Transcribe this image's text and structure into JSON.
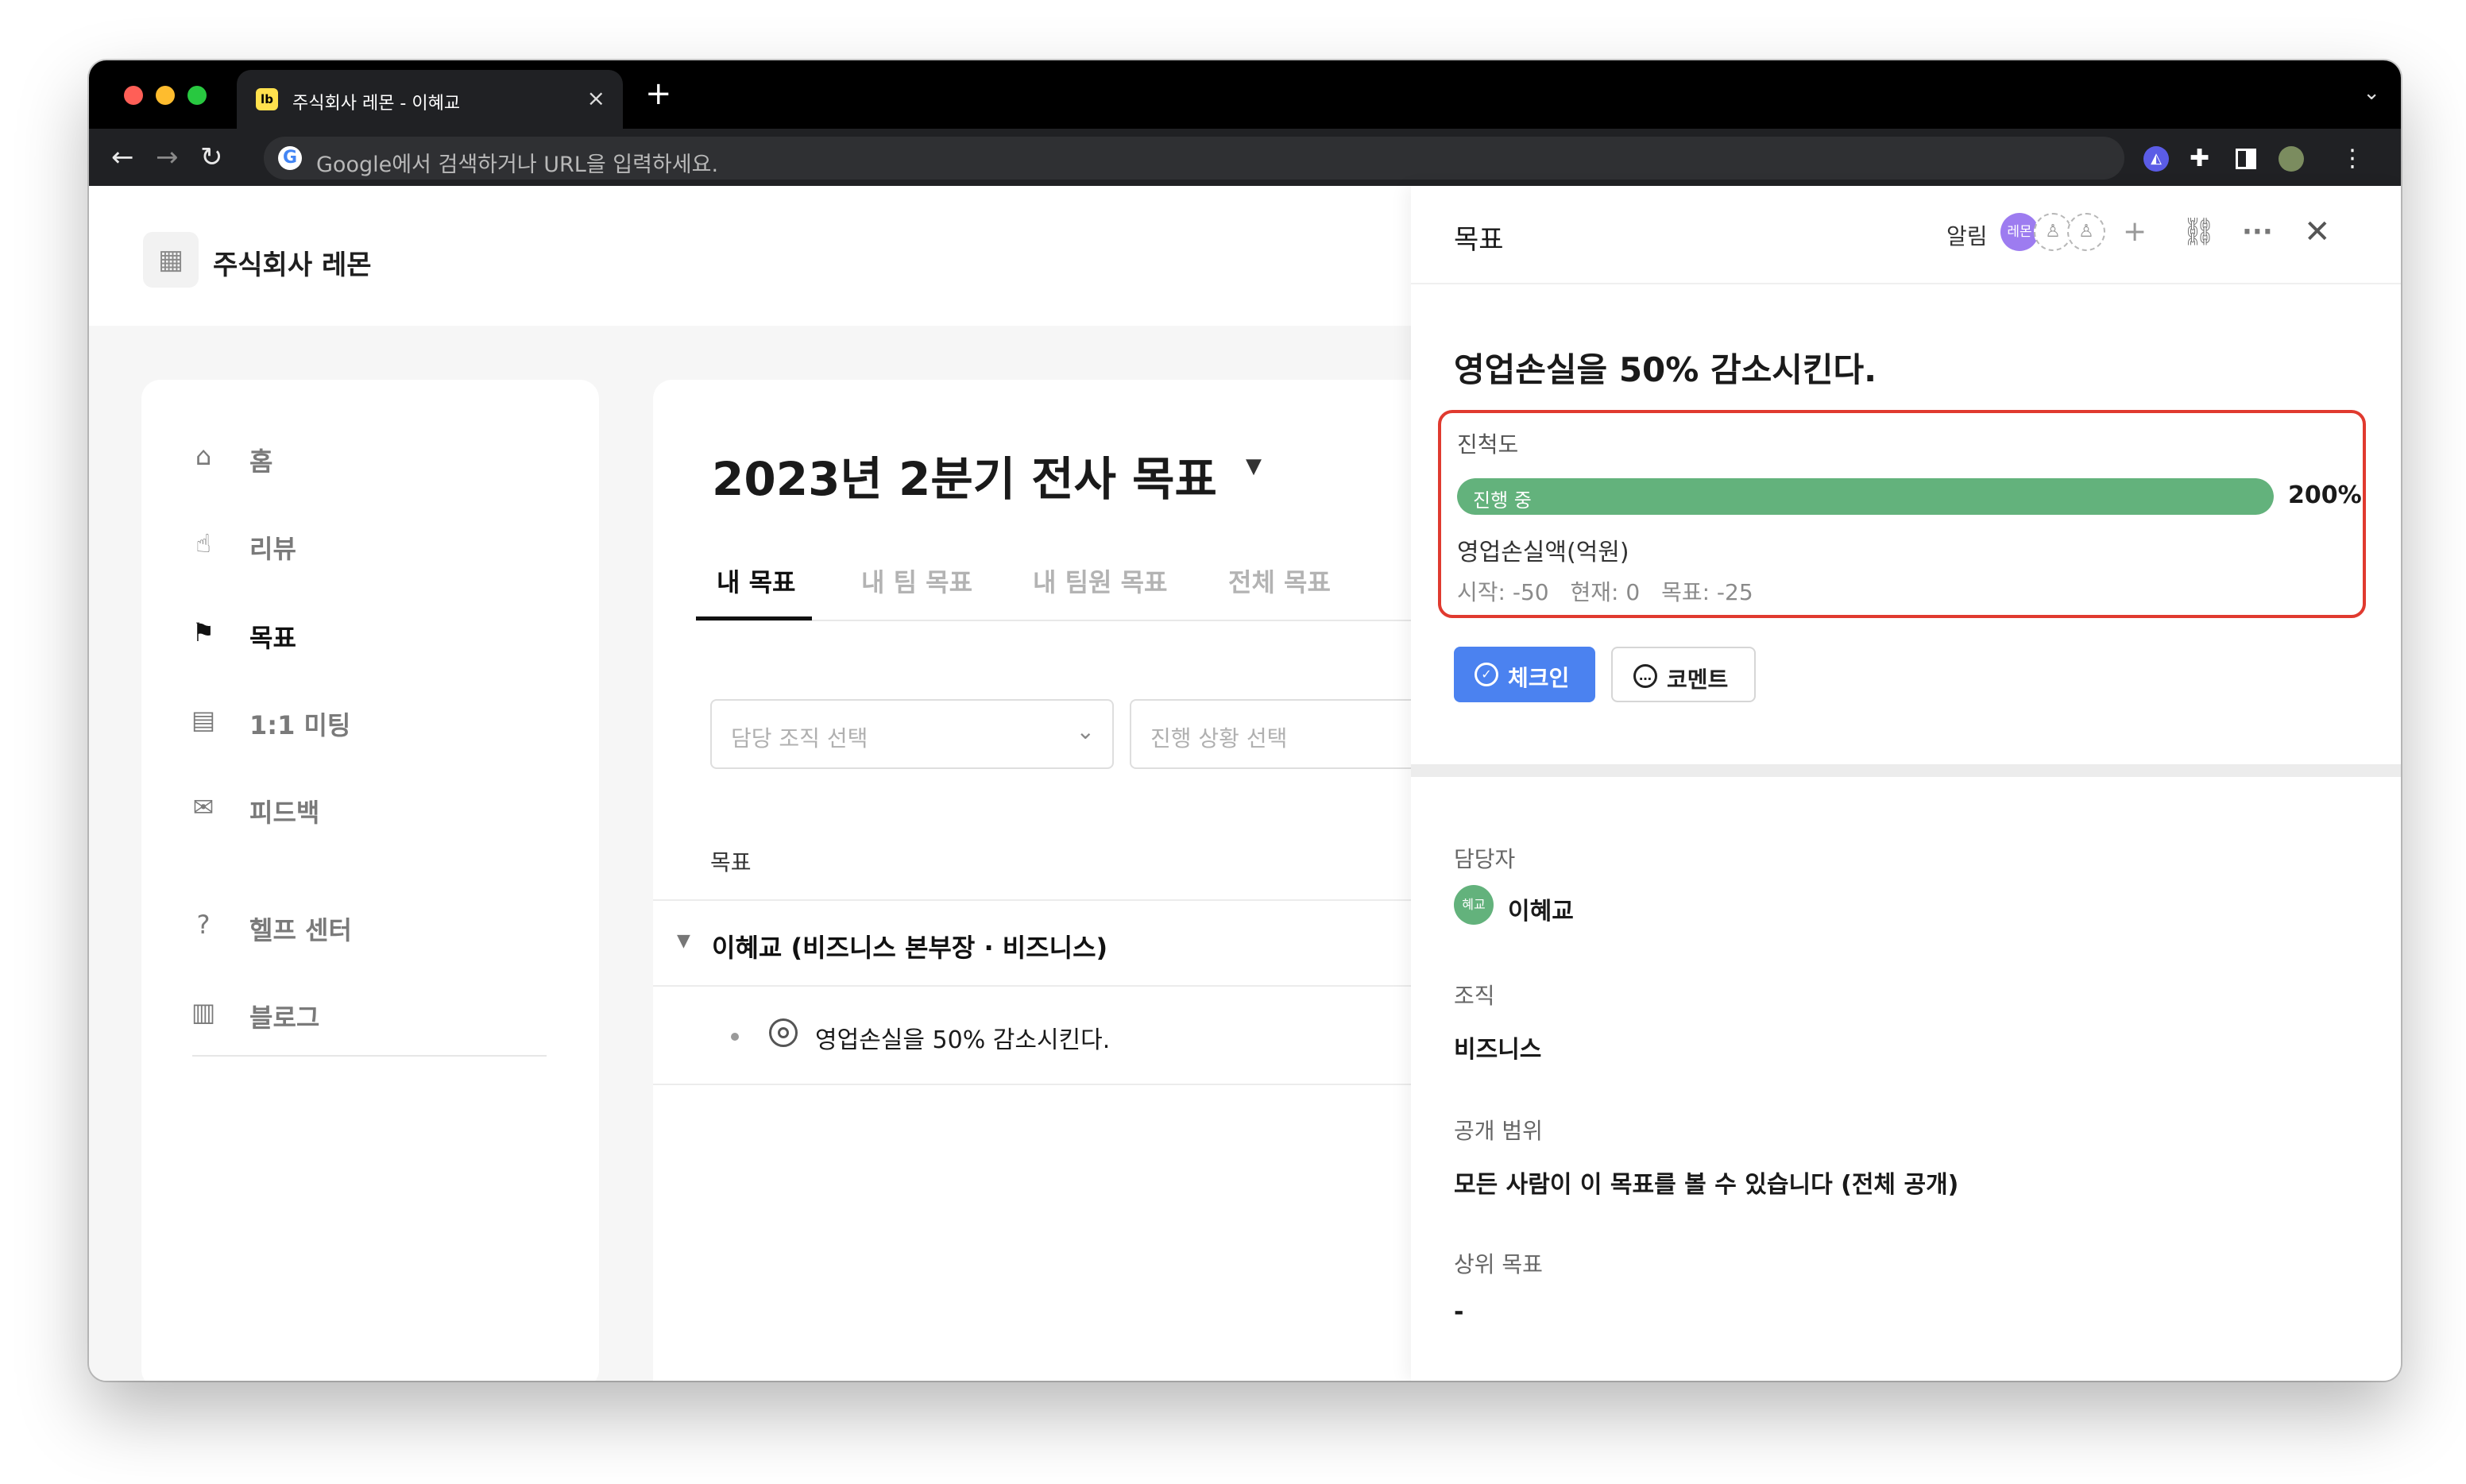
{
  "browser": {
    "tab_title": "주식회사 레몬 - 이혜교",
    "favicon": "lb",
    "tab_close": "×",
    "new_tab": "+",
    "omnibox_placeholder": "Google에서 검색하거나 URL을 입력하세요.",
    "google_logo": "G"
  },
  "org": {
    "name": "주식회사 레몬"
  },
  "sidebar": {
    "items": [
      {
        "label": "홈",
        "icon": "home-icon",
        "active": false
      },
      {
        "label": "리뷰",
        "icon": "thumbs-up-icon",
        "active": false
      },
      {
        "label": "목표",
        "icon": "flag-icon",
        "active": true
      },
      {
        "label": "1:1 미팅",
        "icon": "chat-icon",
        "active": false
      },
      {
        "label": "피드백",
        "icon": "mail-icon",
        "active": false
      },
      {
        "label": "헬프 센터",
        "icon": "help-icon",
        "active": false
      },
      {
        "label": "블로그",
        "icon": "book-icon",
        "active": false
      }
    ]
  },
  "main": {
    "title": "2023년 2분기 전사 목표",
    "tabs": [
      "내 목표",
      "내 팀 목표",
      "내 팀원 목표",
      "전체 목표"
    ],
    "active_tab": 0,
    "filters": [
      {
        "placeholder": "담당 조직 선택"
      },
      {
        "placeholder": "진행 상황 선택"
      }
    ],
    "column_header": "목표",
    "group_label": "이혜교 (비즈니스 본부장 · 비즈니스)",
    "goal_item": "영업손실을 50% 감소시킨다."
  },
  "panel": {
    "title": "목표",
    "notifications_label": "알림",
    "notif_chip": "레몬",
    "goal_title": "영업손실을 50% 감소시킨다.",
    "progress": {
      "label": "진척도",
      "status": "진행 중",
      "percent_text": "200%",
      "fill_fraction": 1.0,
      "metric_name": "영업손실액(억원)",
      "start": "시작: -50",
      "current": "현재: 0",
      "target": "목표: -25"
    },
    "buttons": {
      "checkin": "체크인",
      "comment": "코멘트"
    },
    "fields": {
      "owner_label": "담당자",
      "owner_avatar": "혜교",
      "owner_name": "이혜교",
      "org_label": "조직",
      "org_value": "비즈니스",
      "visibility_label": "공개 범위",
      "visibility_value": "모든 사람이 이 목표를 볼 수 있습니다 (전체 공개)",
      "parent_label": "상위 목표",
      "parent_value": "-"
    }
  },
  "colors": {
    "progress_green": "#63b27c",
    "checkin_blue": "#4b82f0",
    "highlight_red": "#e03a2f",
    "chip_purple": "#9d7cf0"
  }
}
